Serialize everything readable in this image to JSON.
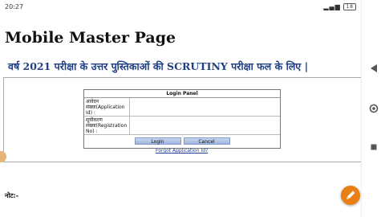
{
  "status": {
    "time": "20:27",
    "battery": "18"
  },
  "header": {
    "title": "Mobile Master Page",
    "subtitle": "वर्ष 2021 परीक्षा के उत्तर पुस्तिकाओं की SCRUTINY परीक्षा फल के लिए |"
  },
  "login_panel": {
    "heading": "Login Panel",
    "application_label": "आवेदन संख्या(Application Id) :",
    "registration_label": "सूचीकरण संख्या(Registration No) :",
    "login_label": "Login",
    "cancel_label": "Cancel",
    "forgot_link": "Forgot Application Id?"
  },
  "note_label": "नोट:-",
  "icons": {
    "edit": "edit-pencil-icon",
    "back": "back-triangle-icon",
    "home": "home-circle-icon",
    "recents": "recents-square-icon"
  },
  "colors": {
    "subtitle": "#1f3f86",
    "fab": "#e97f12",
    "button": "#b4c6e8"
  }
}
